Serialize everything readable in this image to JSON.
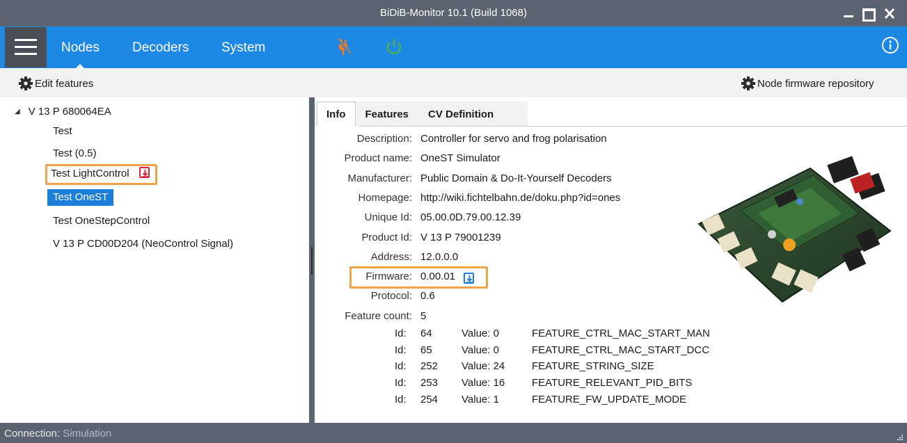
{
  "window": {
    "title": "BiDiB-Monitor 10.1 (Build 1068)"
  },
  "menu": {
    "tabs": [
      "Nodes",
      "Decoders",
      "System"
    ],
    "active_tab": "Nodes"
  },
  "toolbar": {
    "edit_features": "Edit features",
    "firmware_repo": "Node firmware repository"
  },
  "tree": {
    "root": "V 13 P 680064EA",
    "items": [
      {
        "label": "Test"
      },
      {
        "label": "Test (0.5)"
      },
      {
        "label": "Test LightControl",
        "badge": "update-available-icon"
      },
      {
        "label": "Test OneST",
        "selected": true
      },
      {
        "label": "Test OneStepControl"
      },
      {
        "label": "V 13 P CD00D204 (NeoControl Signal)"
      }
    ]
  },
  "detail": {
    "tabs": [
      "Info",
      "Features",
      "CV Definition"
    ],
    "active_tab": "Info",
    "fields": [
      {
        "label": "Description:",
        "value": "Controller for servo and frog polarisation"
      },
      {
        "label": "Product name:",
        "value": "OneST Simulator"
      },
      {
        "label": "Manufacturer:",
        "value": "Public Domain & Do-It-Yourself Decoders"
      },
      {
        "label": "Homepage:",
        "value": "http://wiki.fichtelbahn.de/doku.php?id=ones"
      },
      {
        "label": "Unique Id:",
        "value": "05.00.0D.79.00.12.39"
      },
      {
        "label": "Product Id:",
        "value": "V 13 P 79001239"
      },
      {
        "label": "Address:",
        "value": "12.0.0.0"
      },
      {
        "label": "Firmware:",
        "value": "0.00.01"
      },
      {
        "label": "Protocol:",
        "value": "0.6"
      },
      {
        "label": "Feature count:",
        "value": "5"
      }
    ],
    "features": [
      {
        "id_label": "Id:",
        "id": "64",
        "value": "Value: 0",
        "name": "FEATURE_CTRL_MAC_START_MAN"
      },
      {
        "id_label": "Id:",
        "id": "65",
        "value": "Value: 0",
        "name": "FEATURE_CTRL_MAC_START_DCC"
      },
      {
        "id_label": "Id:",
        "id": "252",
        "value": "Value: 24",
        "name": "FEATURE_STRING_SIZE"
      },
      {
        "id_label": "Id:",
        "id": "253",
        "value": "Value: 16",
        "name": "FEATURE_RELEVANT_PID_BITS"
      },
      {
        "id_label": "Id:",
        "id": "254",
        "value": "Value: 1",
        "name": "FEATURE_FW_UPDATE_MODE"
      }
    ]
  },
  "status": {
    "label": "Connection:",
    "value": "Simulation"
  },
  "colors": {
    "accent": "#1e88e5",
    "chrome": "#5b6270",
    "highlight": "#f4a24a",
    "power_on": "#4caf50",
    "disconnect": "#f07a1e",
    "update_badge": "#d9253b"
  }
}
